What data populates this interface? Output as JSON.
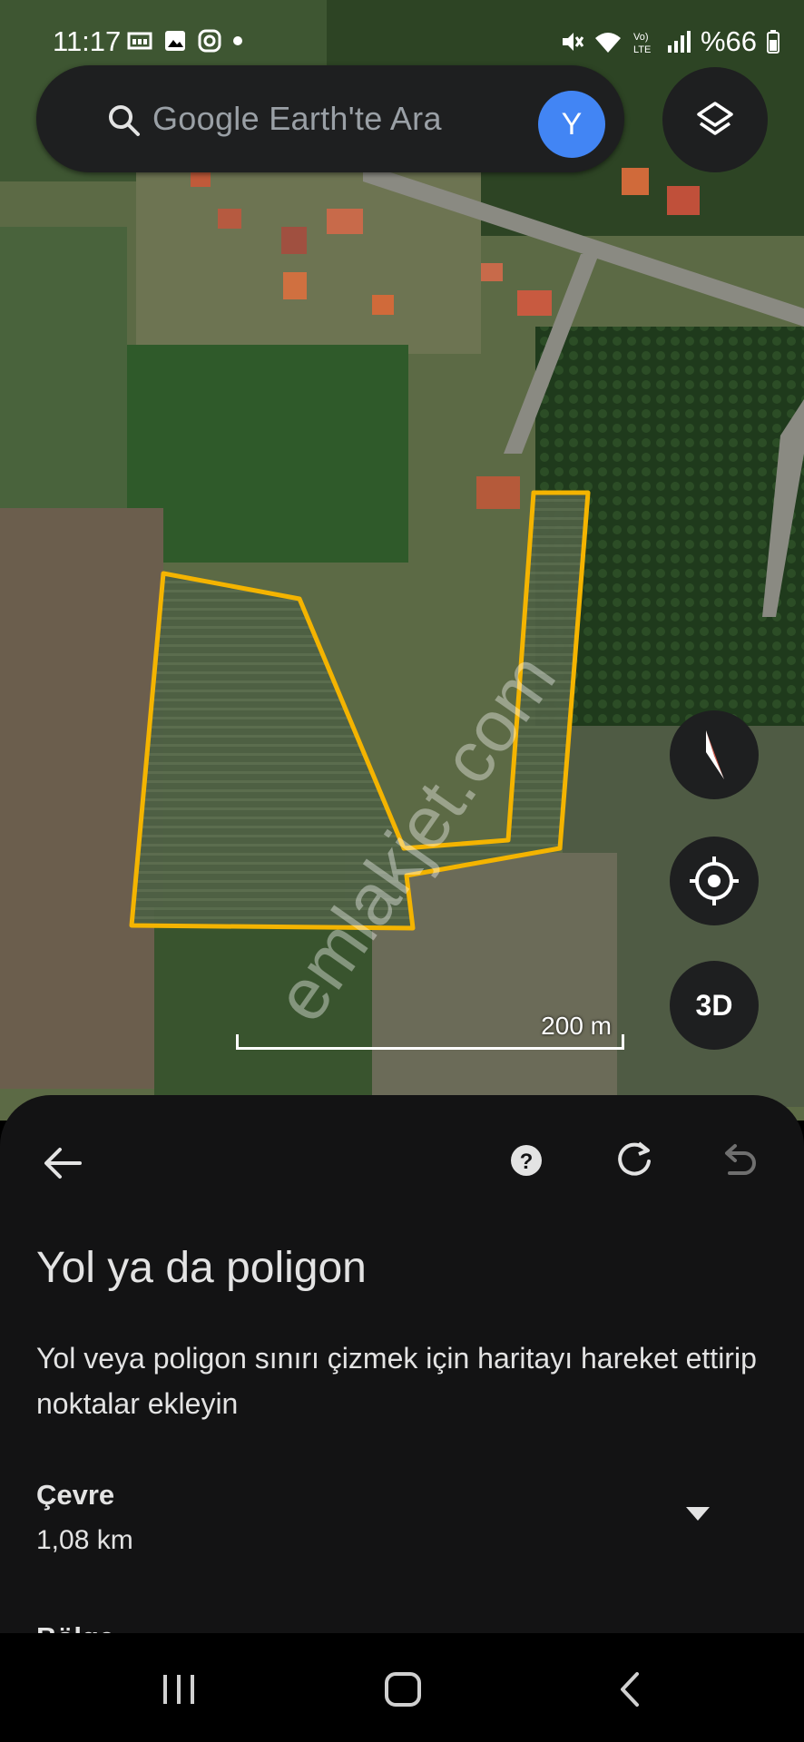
{
  "status": {
    "time": "11:17",
    "battery": "%66"
  },
  "search": {
    "placeholder": "Google Earth'te Ara",
    "avatar_letter": "Y"
  },
  "map": {
    "scale_label": "200 m",
    "watermark": "emlakjet.com",
    "threed_label": "3D",
    "polygon_color": "#f4b400"
  },
  "sheet": {
    "title": "Yol ya da poligon",
    "description": "Yol veya poligon sınırı çizmek için haritayı hareket ettirip noktalar ekleyin",
    "metric_label": "Çevre",
    "metric_value": "1,08 km",
    "next_label": "Bölge"
  },
  "icons": [
    "search-icon",
    "layers-icon",
    "compass-icon",
    "my-location-icon",
    "back-arrow-icon",
    "help-icon",
    "redo-icon",
    "undo-icon",
    "dropdown-icon",
    "recents-icon",
    "home-icon",
    "nav-back-icon"
  ]
}
